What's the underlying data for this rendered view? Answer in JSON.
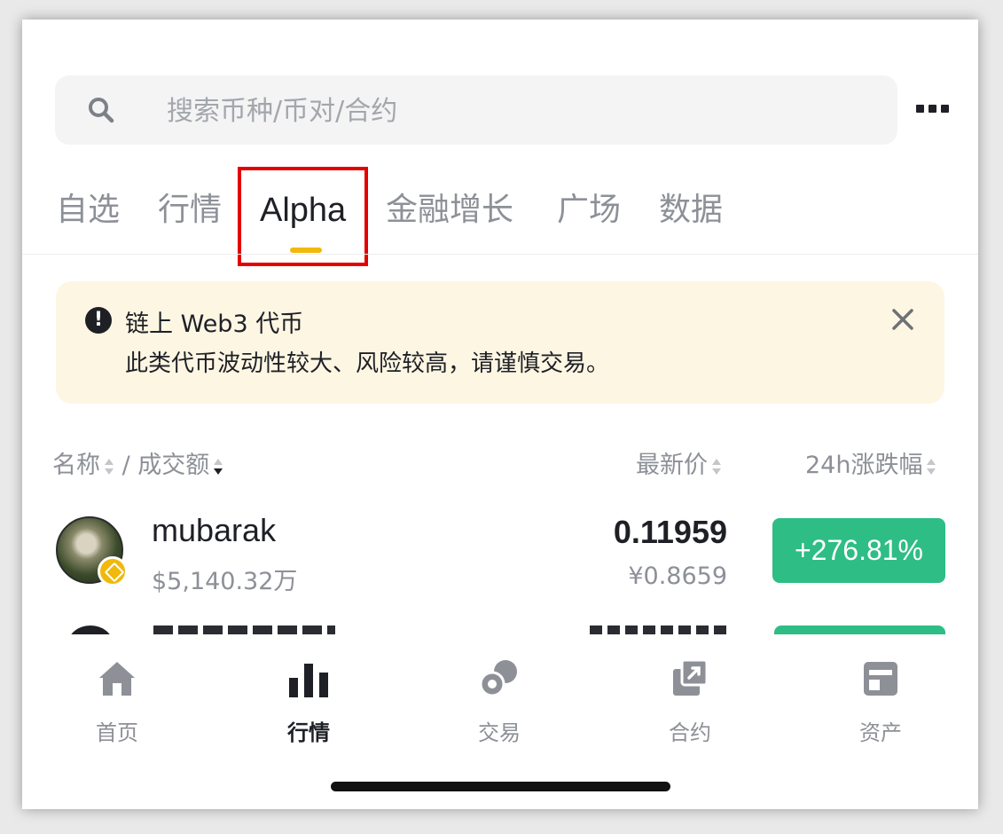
{
  "search": {
    "placeholder": "搜索币种/币对/合约",
    "icon": "search-icon"
  },
  "tabs": [
    {
      "label": "自选",
      "active": false
    },
    {
      "label": "行情",
      "active": false
    },
    {
      "label": "Alpha",
      "active": true
    },
    {
      "label": "金融增长",
      "active": false
    },
    {
      "label": "广场",
      "active": false
    },
    {
      "label": "数据",
      "active": false
    }
  ],
  "notice": {
    "title": "链上 Web3 代币",
    "body": "此类代币波动性较大、风险较高，请谨慎交易。"
  },
  "list_header": {
    "name": "名称",
    "sep": "/",
    "volume": "成交额",
    "price": "最新价",
    "change": "24h涨跌幅"
  },
  "rows": [
    {
      "name": "mubarak",
      "volume": "$5,140.32万",
      "price": "0.11959",
      "fiat": "¥0.8659",
      "change": "+276.81%"
    }
  ],
  "bottom_nav": [
    {
      "label": "首页",
      "icon": "home-icon",
      "active": false
    },
    {
      "label": "行情",
      "icon": "markets-icon",
      "active": true
    },
    {
      "label": "交易",
      "icon": "trade-icon",
      "active": false
    },
    {
      "label": "合约",
      "icon": "futures-icon",
      "active": false
    },
    {
      "label": "资产",
      "icon": "wallet-icon",
      "active": false
    }
  ],
  "colors": {
    "accent": "#f0b90b",
    "up": "#2ebd85",
    "highlight": "#e30000",
    "notice_bg": "#fdf6e3"
  }
}
